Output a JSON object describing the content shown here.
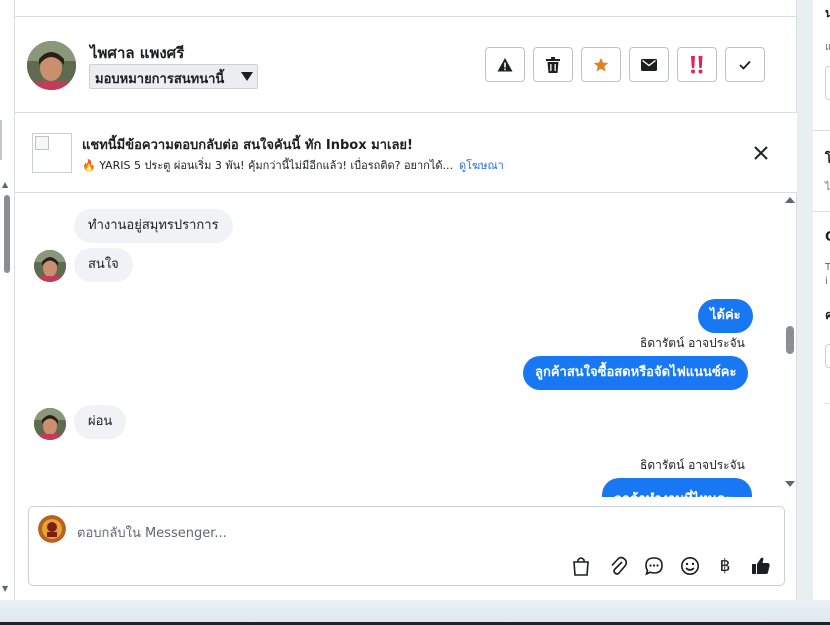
{
  "header": {
    "contact_name": "ไพศาล แพงศรี",
    "assign_label": "มอบหมายการสนทนานี้",
    "actions": [
      {
        "name": "spam-warning-button",
        "icon": "warning-icon"
      },
      {
        "name": "delete-button",
        "icon": "trash-icon"
      },
      {
        "name": "star-button",
        "icon": "star-icon",
        "color": "#e67e22"
      },
      {
        "name": "mark-unread-button",
        "icon": "envelope-icon"
      },
      {
        "name": "follow-up-button",
        "icon": "double-exclamation-icon",
        "color": "#e0245e"
      },
      {
        "name": "mark-done-button",
        "icon": "checkmark-icon"
      }
    ]
  },
  "ad": {
    "title": "แชทนี้มีข้อความตอบกลับต่อ สนใจคันนี้ ทัก Inbox มาเลย!",
    "description": "🔥 YARIS 5 ประตู ผ่อนเริ่ม 3 พัน! คุ้มกว่านี้ไม่มีอีกแล้ว! เบื่อรถติด? อยากได้...",
    "link_label": "ดูโฆษณา"
  },
  "messages": [
    {
      "side": "in",
      "text": "ทำงานอยู่สมุทรปราการ"
    },
    {
      "side": "in",
      "text": "สนใจ"
    },
    {
      "side": "out",
      "text": "ได้ค่ะ"
    },
    {
      "side": "out",
      "sender": "ธิดารัตน์ อาจประจัน",
      "text": "ลูกค้าสนใจซื้อสดหรือจัดไฟแนนซ์คะ"
    },
    {
      "side": "in",
      "text": "ผ่อน"
    },
    {
      "side": "out",
      "sender": "ธิดารัตน์ อาจประจัน",
      "text": "ลูกค้าทำงานที่ไหนคะ"
    }
  ],
  "composer": {
    "placeholder": "ตอบกลับใน Messenger...",
    "tools": [
      {
        "name": "shop-bag-icon",
        "glyph": "🛍"
      },
      {
        "name": "attachment-icon",
        "glyph": "📎"
      },
      {
        "name": "saved-reply-icon",
        "glyph": "💬"
      },
      {
        "name": "emoji-icon",
        "glyph": "☺"
      },
      {
        "name": "payment-baht-icon",
        "glyph": "฿"
      },
      {
        "name": "thumbs-up-icon",
        "glyph": "👍"
      }
    ]
  },
  "colors": {
    "accent": "#1877f2",
    "incoming_bubble": "#f0f2f5",
    "star": "#e67e22",
    "follow_up": "#e0245e"
  }
}
